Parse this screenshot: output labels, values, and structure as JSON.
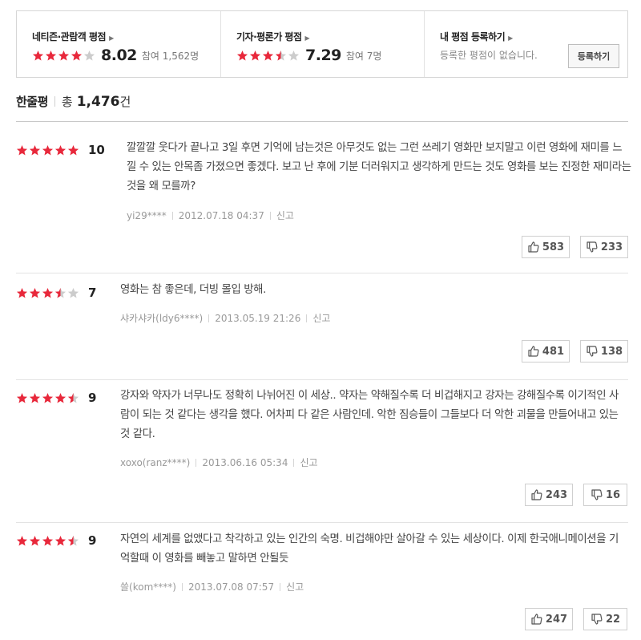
{
  "summary": {
    "netizen": {
      "title": "네티즌·관람객 평점",
      "rating": 4,
      "score": "8.02",
      "count": "참여 1,562명"
    },
    "critic": {
      "title": "기자·평론가 평점",
      "rating": 3.5,
      "score": "7.29",
      "count": "참여 7명"
    },
    "mine": {
      "title": "내 평점 등록하기",
      "empty_text": "등록한 평점이 없습니다.",
      "button_label": "등록하기"
    }
  },
  "header": {
    "title": "한줄평",
    "total_label": "총",
    "count": "1,476",
    "unit": "건"
  },
  "colors": {
    "star_filled": "#e8283b",
    "star_empty": "#cccccc"
  },
  "icons": {
    "like": "thumbs-up-icon",
    "dislike": "thumbs-down-icon",
    "arrow": "chevron-right-icon"
  },
  "reviews": [
    {
      "rating": 5,
      "score": "10",
      "text": "깔깔깔 웃다가 끝나고 3일 후면 기억에 남는것은 아무것도 없는 그런 쓰레기 영화만 보지말고 이런 영화에 재미를 느낄 수 있는 안목좀 가졌으면 좋겠다. 보고 난 후에 기분 더러워지고 생각하게 만드는 것도 영화를 보는 진정한 재미라는 것을 왜 모를까?",
      "author": "yi29****",
      "date": "2012.07.18 04:37",
      "report": "신고",
      "likes": "583",
      "dislikes": "233"
    },
    {
      "rating": 3.5,
      "score": "7",
      "text": "영화는 참 좋은데, 더빙 몰입 방해.",
      "author": "샤카샤카(ldy6****)",
      "date": "2013.05.19 21:26",
      "report": "신고",
      "likes": "481",
      "dislikes": "138"
    },
    {
      "rating": 4.5,
      "score": "9",
      "text": "강자와 약자가 너무나도 정확히 나뉘어진 이 세상.. 약자는 약해질수록 더 비겁해지고 강자는 강해질수록 이기적인 사람이 되는 것 같다는 생각을 했다. 어차피 다 같은 사람인데. 악한 짐승들이 그들보다 더 악한 괴물을 만들어내고 있는 것 같다.",
      "author": "xoxo(ranz****)",
      "date": "2013.06.16 05:34",
      "report": "신고",
      "likes": "243",
      "dislikes": "16"
    },
    {
      "rating": 4.5,
      "score": "9",
      "text": "자연의 세계를 없앴다고 착각하고 있는 인간의 숙명. 비겁해야만 살아갈 수 있는 세상이다. 이제 한국애니메이션을 기억할때 이 영화를 빼놓고 말하면 안될듯",
      "author": "쓸(kom****)",
      "date": "2013.07.08 07:57",
      "report": "신고",
      "likes": "247",
      "dislikes": "22"
    }
  ]
}
